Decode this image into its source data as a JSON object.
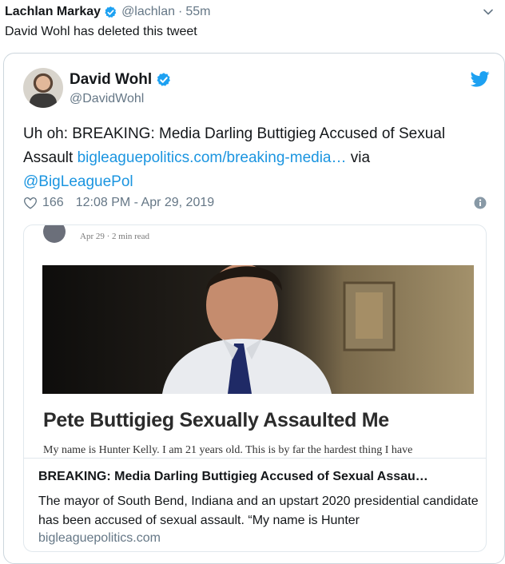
{
  "outer_tweet": {
    "name": "Lachlan Markay",
    "handle": "@lachlan",
    "separator": "·",
    "time": "55m",
    "text": "David Wohl has deleted this tweet"
  },
  "quoted_tweet": {
    "name": "David Wohl",
    "handle": "@DavidWohl",
    "text_prefix": "Uh oh: BREAKING: Media Darling Buttigieg Accused of Sexual Assault",
    "link": "bigleaguepolitics.com/breaking-media…",
    "text_via": "via",
    "mention": "@BigLeaguePol",
    "likes": "166",
    "timestamp": "12:08 PM - Apr 29, 2019"
  },
  "link_card": {
    "snapshot_byline": "Apr 29 · 2 min read",
    "snapshot_title": "Pete Buttigieg Sexually Assaulted Me",
    "snapshot_body": "My name is Hunter Kelly. I am 21 years old. This is by far the hardest thing I have",
    "title": "BREAKING: Media Darling Buttigieg Accused of Sexual Assau…",
    "description": "The mayor of South Bend, Indiana and an upstart 2020 presidential candidate has been accused of sexual assault. “My name is Hunter",
    "domain": "bigleaguepolitics.com"
  },
  "icons": {
    "verified": "verified-badge-icon",
    "chevron": "chevron-down-icon",
    "bird": "twitter-bird-icon",
    "heart": "heart-icon",
    "info": "info-icon"
  },
  "colors": {
    "link": "#1b95e0",
    "verified": "#1da1f2",
    "muted": "#657786",
    "border": "#ccd6dd"
  }
}
